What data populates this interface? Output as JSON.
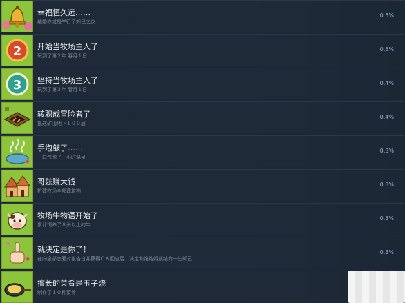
{
  "achievements": [
    {
      "title": "幸福恒久远……",
      "desc": "结婚亦或是举行了知己之仪",
      "percent": "0.5%",
      "icon": "bell-icon"
    },
    {
      "title": "开始当牧场主人了",
      "desc": "玩到了第２年 春月１日",
      "percent": "0.5%",
      "icon": "number-2-icon"
    },
    {
      "title": "坚持当牧场主人了",
      "desc": "玩到了第３年 春月１日",
      "percent": "0.4%",
      "icon": "number-3-icon"
    },
    {
      "title": "转职成冒险者了",
      "desc": "抵达矿山地下１００层",
      "percent": "0.4%",
      "icon": "mine-ladder-icon"
    },
    {
      "title": "手泡皱了……",
      "desc": "一口气泡了十小时温泉",
      "percent": "0.3%",
      "icon": "hot-spring-icon"
    },
    {
      "title": "哥兹赚大钱",
      "desc": "扩建牧场全部建筑物",
      "percent": "0.3%",
      "icon": "farm-buildings-icon"
    },
    {
      "title": "牧场牛物语开始了",
      "desc": "累计饲养了８头以上的牛",
      "percent": "0.3%",
      "icon": "cow-icon"
    },
    {
      "title": "就决定是你了！",
      "desc": "在向全部恋爱对象告白并获得ＯＫ回应后、决定和谁结婚或结为一生知己",
      "percent": "0.3%",
      "icon": "pointing-hand-icon"
    },
    {
      "title": "擅长的菜肴是玉子烧",
      "desc": "制作了１０种菜肴",
      "percent": "",
      "icon": "frying-pan-icon"
    }
  ]
}
